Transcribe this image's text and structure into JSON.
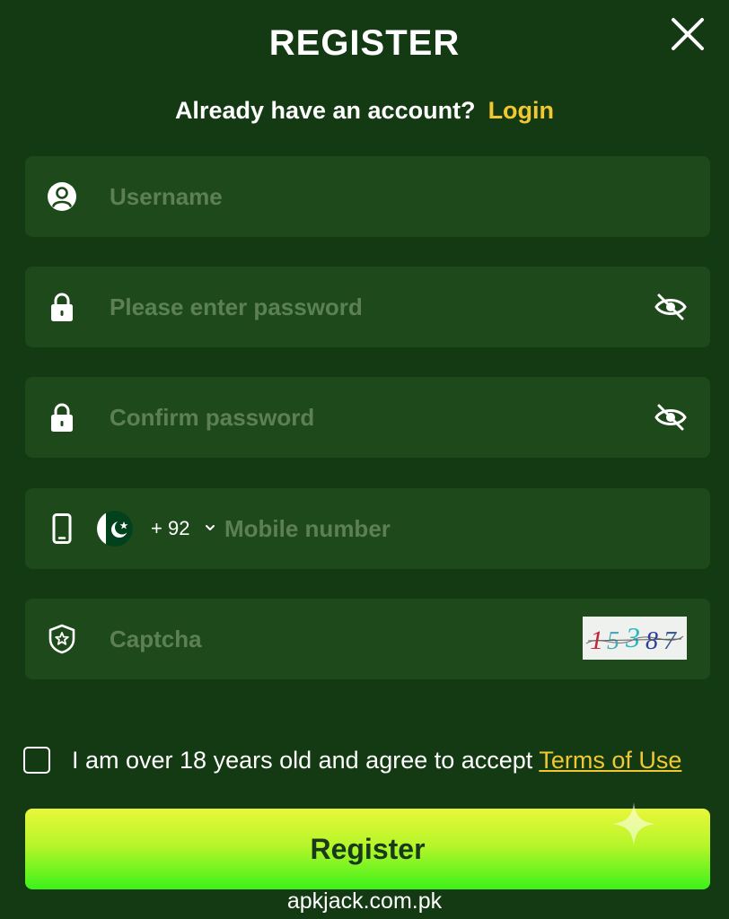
{
  "header": {
    "title": "REGISTER",
    "close_icon": "close-icon"
  },
  "login_prompt": {
    "text": "Already have an account?",
    "link": "Login"
  },
  "fields": {
    "username": {
      "icon": "user-icon",
      "placeholder": "Username",
      "value": ""
    },
    "password": {
      "icon": "lock-icon",
      "placeholder": "Please enter password",
      "value": "",
      "toggle_icon": "eye-off-icon"
    },
    "confirm_password": {
      "icon": "lock-icon",
      "placeholder": "Confirm password",
      "value": "",
      "toggle_icon": "eye-off-icon"
    },
    "mobile": {
      "icon": "phone-icon",
      "flag_icon": "pakistan-flag-icon",
      "country_code": "+ 92",
      "dropdown_icon": "chevron-down-icon",
      "placeholder": "Mobile number",
      "value": ""
    },
    "captcha": {
      "icon": "shield-star-icon",
      "placeholder": "Captcha",
      "value": "",
      "captcha_text": "15387"
    }
  },
  "terms": {
    "checked": false,
    "text": "I am over 18 years old and agree to accept ",
    "link": "Terms of Use"
  },
  "register_button": {
    "label": "Register"
  },
  "watermark": "apkjack.com.pk",
  "colors": {
    "background": "#133a13",
    "field_background": "#1e4a1b",
    "accent_link": "#f2c832",
    "placeholder": "#5d7f55",
    "button_gradient_top": "#e8f73a",
    "button_gradient_bottom": "#3cf21a",
    "button_text": "#18391a"
  }
}
